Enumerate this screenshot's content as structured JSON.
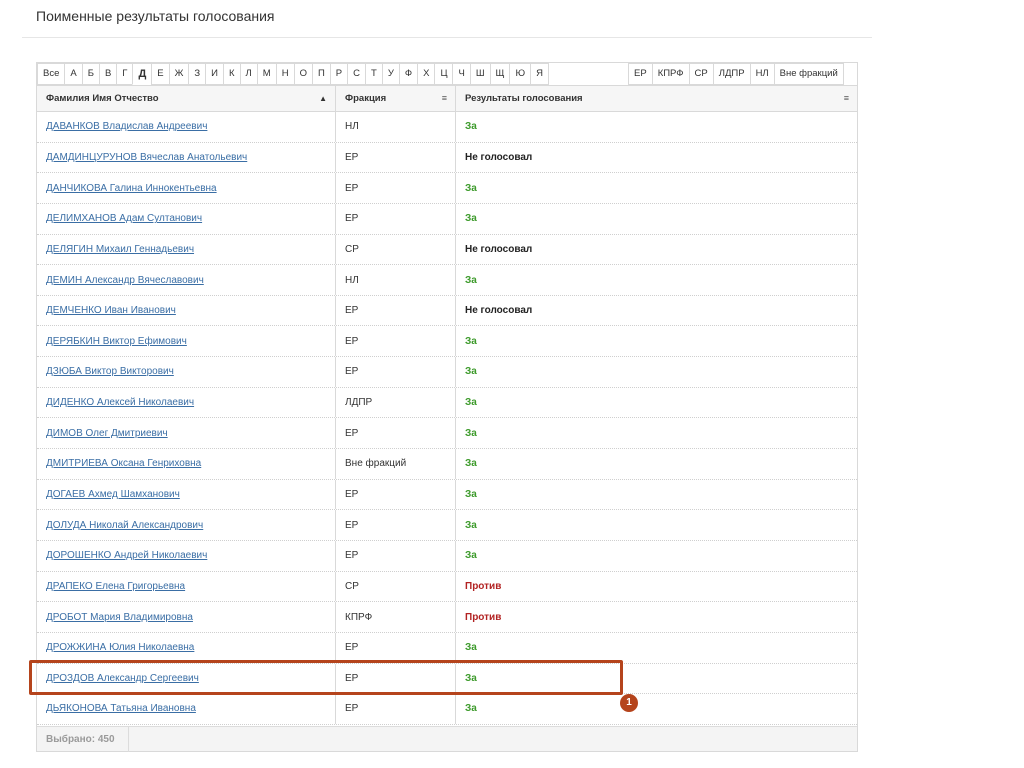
{
  "page": {
    "title": "Поименные результаты голосования"
  },
  "filters": {
    "letters": [
      "Все",
      "А",
      "Б",
      "В",
      "Г",
      "Д",
      "Е",
      "Ж",
      "З",
      "И",
      "К",
      "Л",
      "М",
      "Н",
      "О",
      "П",
      "Р",
      "С",
      "Т",
      "У",
      "Ф",
      "Х",
      "Ц",
      "Ч",
      "Ш",
      "Щ",
      "Ю",
      "Я"
    ],
    "active_letter": "Д",
    "factions": [
      "ЕР",
      "КПРФ",
      "СР",
      "ЛДПР",
      "НЛ",
      "Вне фракций"
    ]
  },
  "table": {
    "columns": {
      "name": "Фамилия Имя Отчество",
      "fraction": "Фракция",
      "result": "Результаты голосования"
    },
    "sort_icon": "sort-ascending-icon",
    "menu_icon": "column-menu-icon",
    "rows": [
      {
        "name": "ДАВАНКОВ Владислав Андреевич",
        "fraction": "НЛ",
        "result": "За"
      },
      {
        "name": "ДАМДИНЦУРУНОВ Вячеслав Анатольевич",
        "fraction": "ЕР",
        "result": "Не голосовал"
      },
      {
        "name": "ДАНЧИКОВА Галина Иннокентьевна",
        "fraction": "ЕР",
        "result": "За"
      },
      {
        "name": "ДЕЛИМХАНОВ Адам Султанович",
        "fraction": "ЕР",
        "result": "За"
      },
      {
        "name": "ДЕЛЯГИН Михаил Геннадьевич",
        "fraction": "СР",
        "result": "Не голосовал"
      },
      {
        "name": "ДЕМИН Александр Вячеславович",
        "fraction": "НЛ",
        "result": "За"
      },
      {
        "name": "ДЕМЧЕНКО Иван Иванович",
        "fraction": "ЕР",
        "result": "Не голосовал"
      },
      {
        "name": "ДЕРЯБКИН Виктор Ефимович",
        "fraction": "ЕР",
        "result": "За"
      },
      {
        "name": "ДЗЮБА Виктор Викторович",
        "fraction": "ЕР",
        "result": "За"
      },
      {
        "name": "ДИДЕНКО Алексей Николаевич",
        "fraction": "ЛДПР",
        "result": "За"
      },
      {
        "name": "ДИМОВ Олег Дмитриевич",
        "fraction": "ЕР",
        "result": "За"
      },
      {
        "name": "ДМИТРИЕВА Оксана Генриховна",
        "fraction": "Вне фракций",
        "result": "За"
      },
      {
        "name": "ДОГАЕВ Ахмед Шамханович",
        "fraction": "ЕР",
        "result": "За"
      },
      {
        "name": "ДОЛУДА Николай Александрович",
        "fraction": "ЕР",
        "result": "За"
      },
      {
        "name": "ДОРОШЕНКО Андрей Николаевич",
        "fraction": "ЕР",
        "result": "За"
      },
      {
        "name": "ДРАПЕКО Елена Григорьевна",
        "fraction": "СР",
        "result": "Против"
      },
      {
        "name": "ДРОБОТ Мария Владимировна",
        "fraction": "КПРФ",
        "result": "Против"
      },
      {
        "name": "ДРОЖЖИНА Юлия Николаевна",
        "fraction": "ЕР",
        "result": "За"
      },
      {
        "name": "ДРОЗДОВ Александр Сергеевич",
        "fraction": "ЕР",
        "result": "За"
      },
      {
        "name": "ДЬЯКОНОВА Татьяна Ивановна",
        "fraction": "ЕР",
        "result": "За"
      }
    ]
  },
  "footer": {
    "selected": "Выбрано: 450"
  },
  "annotation": {
    "marker": "1",
    "color": "#b5441c"
  },
  "colors": {
    "za": "#3c9a2a",
    "protiv": "#b22222",
    "link": "#3a6ea5"
  }
}
